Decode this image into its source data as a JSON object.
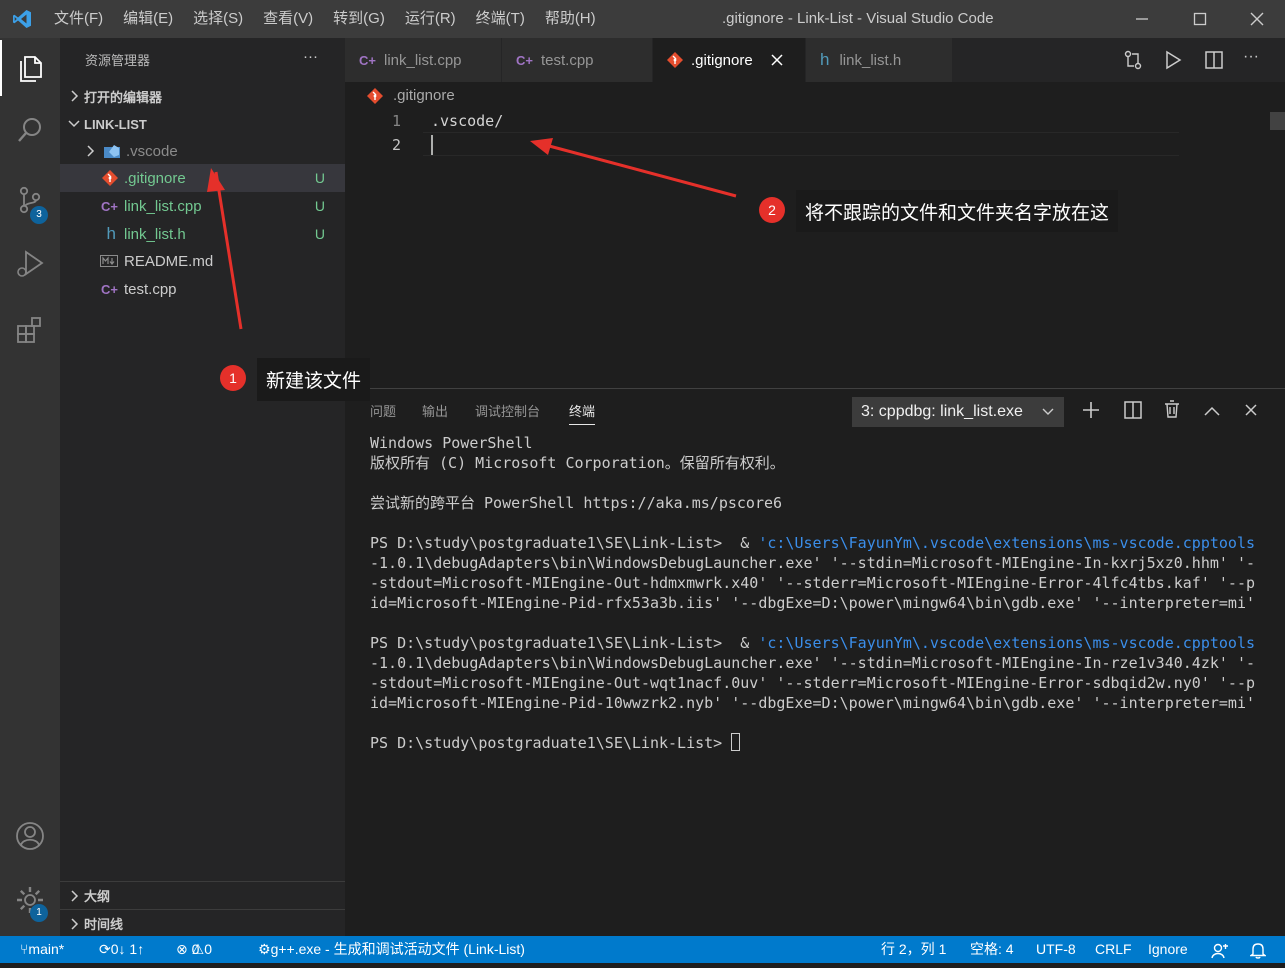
{
  "titlebar": {
    "menus": [
      "文件(F)",
      "编辑(E)",
      "选择(S)",
      "查看(V)",
      "转到(G)",
      "运行(R)",
      "终端(T)",
      "帮助(H)"
    ],
    "title": ".gitignore - Link-List - Visual Studio Code"
  },
  "activity": {
    "scm_badge": "3",
    "settings_badge": "1"
  },
  "sidebar": {
    "header": "资源管理器",
    "more": "···",
    "open_editors": "打开的编辑器",
    "project": "LINK-LIST",
    "files": [
      {
        "name": ".vscode",
        "status": ""
      },
      {
        "name": ".gitignore",
        "status": "U"
      },
      {
        "name": "link_list.cpp",
        "status": "U"
      },
      {
        "name": "link_list.h",
        "status": "U"
      },
      {
        "name": "README.md",
        "status": ""
      },
      {
        "name": "test.cpp",
        "status": ""
      }
    ],
    "outline": "大纲",
    "timeline": "时间线"
  },
  "tabs": [
    {
      "label": "link_list.cpp"
    },
    {
      "label": "test.cpp"
    },
    {
      "label": ".gitignore"
    },
    {
      "label": "link_list.h"
    }
  ],
  "editor": {
    "breadcrumb": ".gitignore",
    "lines": [
      {
        "num": "1",
        "text": ".vscode/"
      },
      {
        "num": "2",
        "text": ""
      }
    ]
  },
  "panel": {
    "tabs": [
      "问题",
      "输出",
      "调试控制台",
      "终端"
    ],
    "terminal_select": "3: cppdbg: link_list.exe",
    "terminal": {
      "l1": "Windows PowerShell",
      "l2": "版权所有 (C) Microsoft Corporation。保留所有权利。",
      "l3": "尝试新的跨平台 PowerShell https://aka.ms/pscore6",
      "ps": "PS D:\\study\\postgraduate1\\SE\\Link-List>  & ",
      "a1": "'c:\\Users\\FayunYm\\.vscode\\extensions\\ms-vscode.cpptools",
      "a2": "-1.0.1\\debugAdapters\\bin\\WindowsDebugLauncher.exe' '--stdin=Microsoft-MIEngine-In-kxrj5xz0.hhm' '-",
      "a3": "-stdout=Microsoft-MIEngine-Out-hdmxmwrk.x40' '--stderr=Microsoft-MIEngine-Error-4lfc4tbs.kaf' '--p",
      "a4": "id=Microsoft-MIEngine-Pid-rfx53a3b.iis' '--dbgExe=D:\\power\\mingw64\\bin\\gdb.exe' '--interpreter=mi'",
      "b1": "'c:\\Users\\FayunYm\\.vscode\\extensions\\ms-vscode.cpptools",
      "b2": "-1.0.1\\debugAdapters\\bin\\WindowsDebugLauncher.exe' '--stdin=Microsoft-MIEngine-In-rze1v340.4zk' '-",
      "b3": "-stdout=Microsoft-MIEngine-Out-wqt1nacf.0uv' '--stderr=Microsoft-MIEngine-Error-sdbqid2w.ny0' '--p",
      "b4": "id=Microsoft-MIEngine-Pid-10wwzrk2.nyb' '--dbgExe=D:\\power\\mingw64\\bin\\gdb.exe' '--interpreter=mi'",
      "prompt": "PS D:\\study\\postgraduate1\\SE\\Link-List> "
    }
  },
  "statusbar": {
    "branch": "main*",
    "sync": "0↓ 1↑",
    "problems": "0",
    "warnings": "0",
    "task": "g++.exe - 生成和调试活动文件 (Link-List)",
    "position": "行 2，列 1",
    "spaces": "空格: 4",
    "encoding": "UTF-8",
    "eol": "CRLF",
    "lang": "Ignore"
  },
  "annotations": {
    "n1": "1",
    "c1": "新建该文件",
    "n2": "2",
    "c2": "将不跟踪的文件和文件夹名字放在这"
  },
  "colors": {
    "accent": "#007acc",
    "annotation": "#e5302a",
    "untracked": "#73c991"
  }
}
